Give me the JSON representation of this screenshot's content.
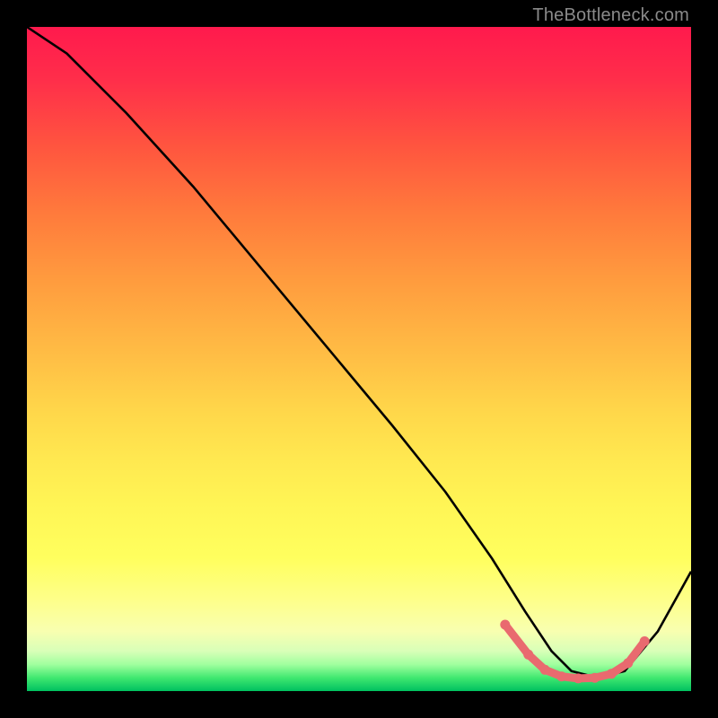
{
  "watermark": "TheBottleneck.com",
  "chart_data": {
    "type": "line",
    "title": "",
    "xlabel": "",
    "ylabel": "",
    "xlim": [
      0,
      100
    ],
    "ylim": [
      0,
      100
    ],
    "grid": false,
    "legend": false,
    "series": [
      {
        "name": "curve",
        "x": [
          0,
          6,
          15,
          25,
          35,
          45,
          55,
          63,
          70,
          75,
          79,
          82,
          86,
          90,
          95,
          100
        ],
        "values": [
          100,
          96,
          87,
          76,
          64,
          52,
          40,
          30,
          20,
          12,
          6,
          3,
          2,
          3,
          9,
          18
        ]
      }
    ],
    "highlight_segment": {
      "name": "optimal-zone",
      "color_hex": "#e96a6f",
      "x": [
        72,
        75.5,
        78,
        80.5,
        83,
        85.5,
        88,
        90.5,
        93
      ],
      "values": [
        10,
        5.5,
        3.2,
        2.2,
        1.9,
        2.0,
        2.6,
        4.2,
        7.5
      ]
    }
  },
  "colors": {
    "bg": "#000000",
    "curve": "#000000",
    "highlight": "#e96a6f",
    "watermark": "#8a8a8a"
  }
}
